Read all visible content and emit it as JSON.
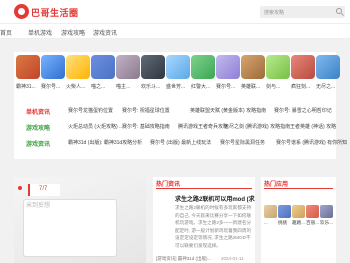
{
  "site": {
    "name": "巴哥生活圈"
  },
  "search": {
    "placeholder": "搜索攻略"
  },
  "nav": {
    "items": [
      "首页",
      "单机游戏",
      "游戏攻略",
      "游戏资讯"
    ]
  },
  "apps": [
    {
      "name": "霸神31...",
      "color": "#c4432b"
    },
    {
      "name": "赛尔号...",
      "color": "#2f6fd0"
    },
    {
      "name": "火柴人...",
      "color": "#ffb300"
    },
    {
      "name": "喵之...",
      "color": "#4a73c4"
    },
    {
      "name": "喵主...",
      "color": "#8b7a8f"
    },
    {
      "name": "欢乐斗...",
      "color": "#30363e"
    },
    {
      "name": "盛世芳...",
      "color": "#5aa9e6"
    },
    {
      "name": "红警大...",
      "color": "#3aa655"
    },
    {
      "name": "赛尔号...",
      "color": "#8e7fd4"
    },
    {
      "name": "英雄联...",
      "color": "#9d6b3a"
    },
    {
      "name": "剑与...",
      "color": "#76c043"
    },
    {
      "name": "疯狂刻...",
      "color": "#b94a3f"
    },
    {
      "name": "无尽之...",
      "color": "#3b82c4"
    }
  ],
  "categories": [
    {
      "label": "单机资讯",
      "color": "#e53935",
      "links": [
        "赛尔号龙猫蛋钓位置",
        "赛尔号: 祝福星球位置",
        "英雄联盟天赋 (黄金版本) 攻略指南",
        "赛尔号: 暴雪之心明哲印记"
      ]
    },
    {
      "name": "gaming",
      "label": "游戏攻略",
      "color": "#43a047",
      "links": [
        "火炬总动员 (火炬攻略) ...",
        "赛尔号: 基础攻略指南",
        "腾讯游戏王者奇兵攻略",
        "无尽之剑 (腾讯游戏) 攻略指南",
        "王者英雄 (神话) 攻略"
      ]
    },
    {
      "label": "游戏资讯",
      "color": "#43a047",
      "links": [
        "霸神31d (出版): 霸神31d攻略分析",
        "赛尔号 (出版) 最新上线玩法",
        "赛尔号星际黑洞任务",
        "赛尔号谱系 (腾讯游戏) 有你所知"
      ]
    }
  ],
  "slider": {
    "counter": "7/7",
    "caption": "米到妄想"
  },
  "hot_news": {
    "title": "热门资讯",
    "article_title": "求生之路2联机可以用mod (求生...",
    "article_body": "求生之路2联机的时候有多玩家都支持的自己, 今天就来比赛分享一下如何联机玩游戏。求生之路2多一一新建名分配定时, 游一般计划新鸡玩着我四周的设定定设定等情况, 求生之路2MOD不可以联要们发现选择。",
    "link": "[游戏资讯] 霸神31d (出版)...",
    "date": "2024-01-11"
  },
  "hot_apps": {
    "title": "热门应用",
    "items": [
      {
        "name": "...",
        "color": "#c9a56b"
      },
      {
        "name": "挑挑",
        "color": "#4c6fbf"
      },
      {
        "name": "趣路...",
        "color": "#caa15b"
      },
      {
        "name": "百丽...",
        "color": "#d35c4a"
      },
      {
        "name": "欢乐...",
        "color": "#6a6f93"
      }
    ]
  }
}
